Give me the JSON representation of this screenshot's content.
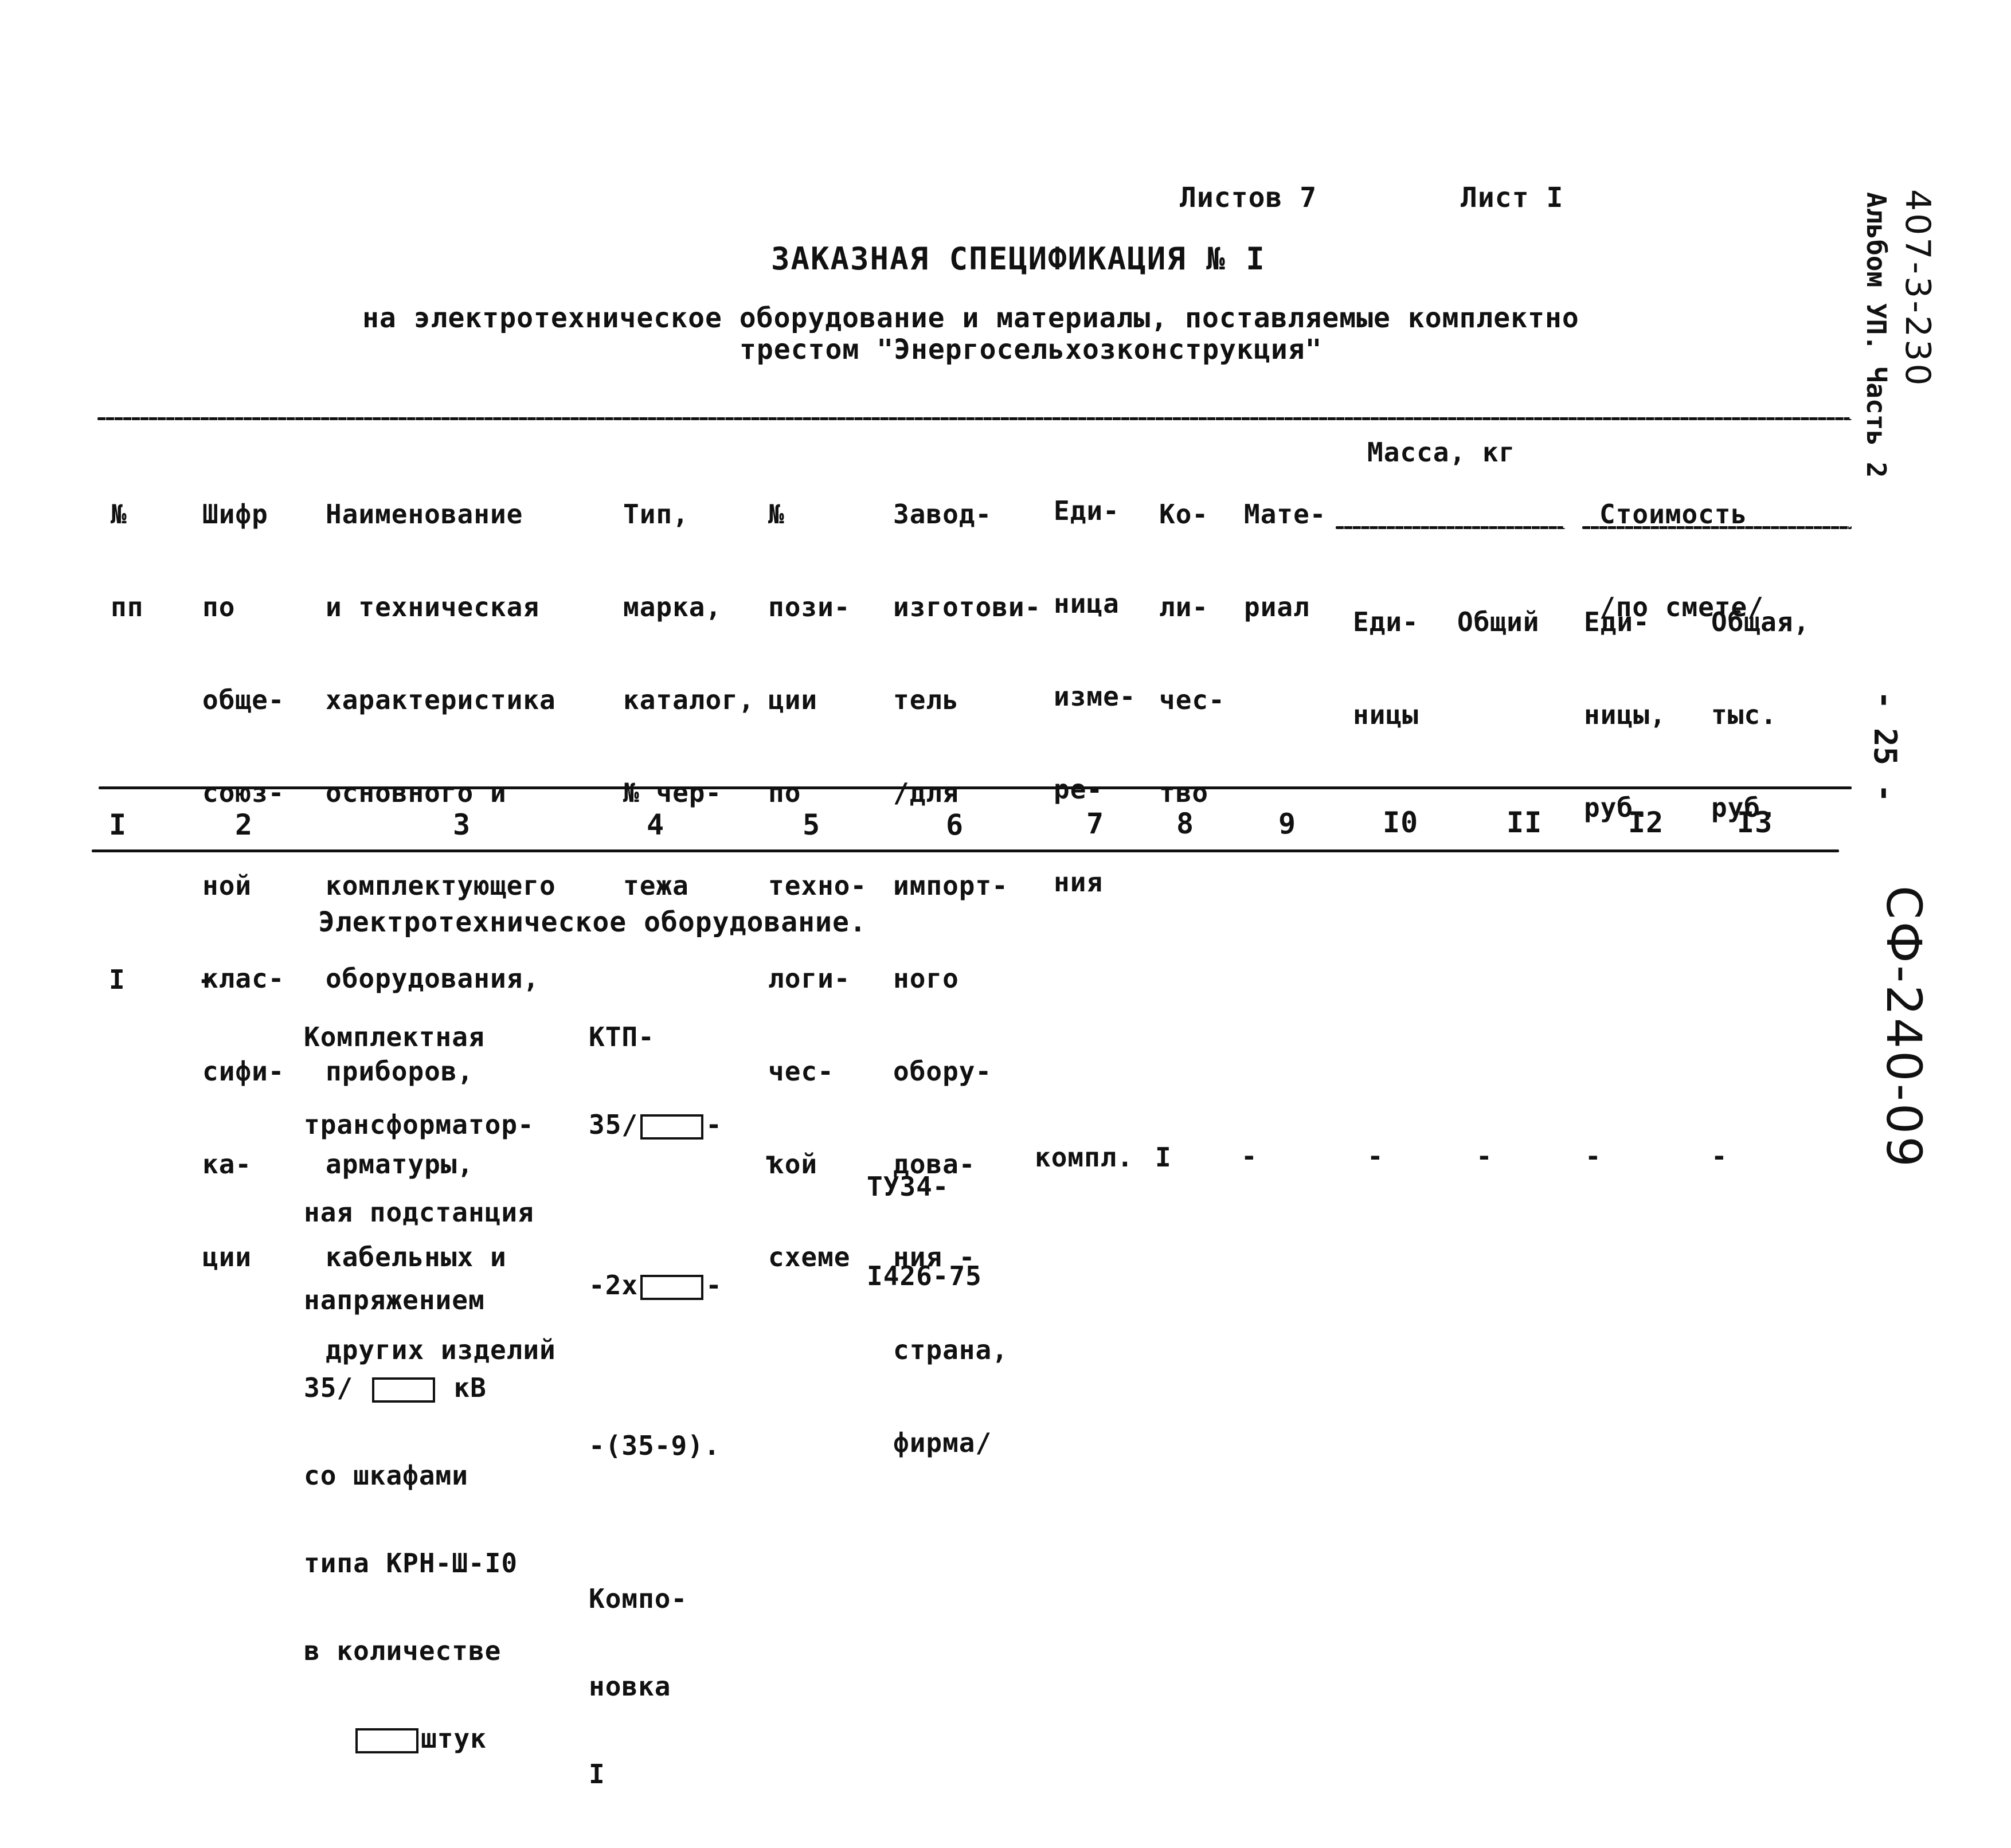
{
  "header": {
    "sheets_total": "Листов 7",
    "sheet_number": "Лист I",
    "title": "ЗАКАЗНАЯ СПЕЦИФИКАЦИЯ № I",
    "subtitle_line1": "на электротехническое оборудование и материалы, поставляемые комплектно",
    "subtitle_line2": "трестом \"Энергосельхозконструкция\""
  },
  "margin": {
    "project_code": "407-3-230",
    "album": "Альбом УП. Часть 2",
    "page": "- 25 -",
    "doc_code": "СФ-240-09"
  },
  "table": {
    "columns": [
      {
        "num": "I",
        "header": [
          "№",
          "пп"
        ]
      },
      {
        "num": "2",
        "header": [
          "Шифр",
          "по",
          "обще-",
          "союз-",
          "ной",
          "клас-",
          "сифи-",
          "ка-",
          "ции"
        ]
      },
      {
        "num": "3",
        "header": [
          "Наименование",
          "и техническая",
          "характеристика",
          "основного и",
          "комплектующего",
          "оборудования,",
          "приборов,",
          "арматуры,",
          "кабельных и",
          "других изделий"
        ]
      },
      {
        "num": "4",
        "header": [
          "Тип,",
          "марка,",
          "каталог,",
          "№ чер-",
          "тежа"
        ]
      },
      {
        "num": "5",
        "header": [
          "№",
          "пози-",
          "ции",
          "по",
          "техно-",
          "логи-",
          "чес-",
          "кой",
          "схеме"
        ]
      },
      {
        "num": "6",
        "header": [
          "Завод-",
          "изготови-",
          "тель",
          "/для",
          "импорт-",
          "ного",
          "обору-",
          "дова-",
          "ния -",
          "страна,",
          "фирма/"
        ]
      },
      {
        "num": "7",
        "header": [
          "Еди-",
          "ница",
          "изме-",
          "ре-",
          "ния"
        ]
      },
      {
        "num": "8",
        "header": [
          "Ко-",
          "ли-",
          "чес-",
          "тво"
        ]
      },
      {
        "num": "9",
        "header": [
          "Мате-",
          "риал"
        ]
      },
      {
        "num": "I0",
        "group": "Масса, кг",
        "header": [
          "Еди-",
          "ницы"
        ]
      },
      {
        "num": "II",
        "group": "Масса, кг",
        "header": [
          "Общий"
        ]
      },
      {
        "num": "I2",
        "group": "Стоимость /по смете/",
        "header": [
          "Еди-",
          "ницы,",
          "руб."
        ]
      },
      {
        "num": "I3",
        "group": "Стоимость /по смете/",
        "header": [
          "Общая,",
          "тыс.",
          "руб."
        ]
      }
    ],
    "groups": {
      "mass": "Масса, кг",
      "cost_line1": "Стоимость",
      "cost_line2": "/по смете/"
    },
    "section_heading": "Электротехническое оборудование.",
    "rows": [
      {
        "pp": "I",
        "code": "-",
        "name": [
          "Комплектная",
          "трансформатор-",
          "ная подстанция",
          "напряжением",
          "35/ [  ] кВ",
          "со шкафами",
          "типа КРН-Ш-I0",
          "в количестве",
          "[  ]штук"
        ],
        "type": [
          "КТП-",
          "35/[  ]-",
          "-2x[  ]-",
          "-(35-9).",
          "Компо-",
          "новка",
          "I"
        ],
        "position": "-",
        "manufacturer": [
          "ТУ34-",
          "I426-75"
        ],
        "unit": "компл.",
        "quantity": "I",
        "material": "-",
        "mass_unit": "-",
        "mass_total": "-",
        "cost_unit": "-",
        "cost_total": "-"
      }
    ]
  }
}
